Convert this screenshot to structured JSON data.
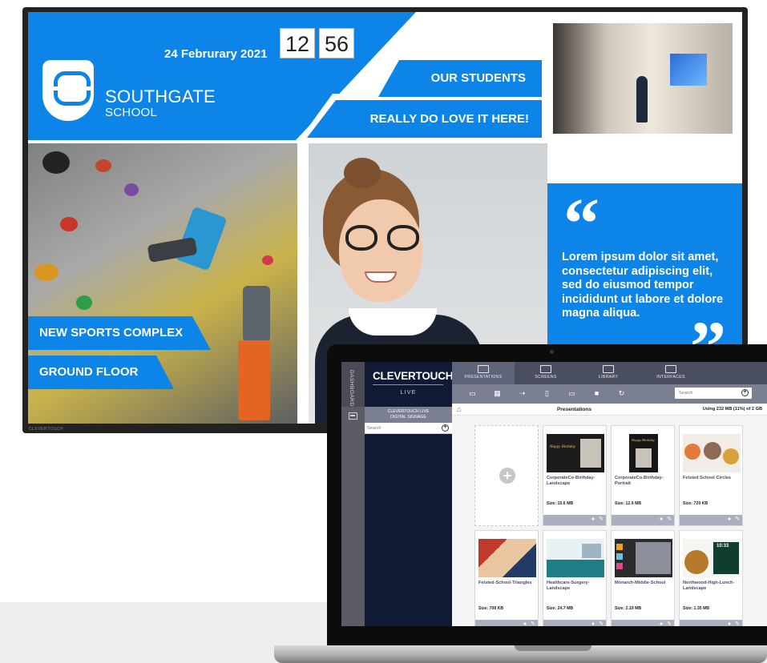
{
  "signage": {
    "date": "24 Februrary 2021",
    "clock_hours": "12",
    "clock_minutes": "56",
    "school_name": "SOUTHGATE",
    "school_sub": "SCHOOL",
    "banner_1": "OUR STUDENTS",
    "banner_2": "REALLY DO LOVE IT HERE!",
    "sports_1": "NEW SPORTS COMPLEX",
    "sports_2": "GROUND FLOOR",
    "quote": "Lorem ipsum dolor sit amet, consectetur adipiscing elit, sed do eiusmod tempor incididunt ut labore et dolore magna aliqua.",
    "quote_open": "“",
    "quote_close": "”",
    "tv_brand": "CLEVERTOUCH"
  },
  "app": {
    "dashboard_label": "DASHBOARD",
    "brand": "CLEVERTOUCH®",
    "brand_sub": "LIVE",
    "nav": [
      "PRESENTATIONS",
      "SCREENS",
      "LIBRARY",
      "INTERFACES"
    ],
    "search_placeholder": "Search",
    "side_title_1": "CLEVERTOUCH LIVE",
    "side_title_2": "DIGITAL SIGNAGE",
    "side_search_placeholder": "Search",
    "page_title": "Presentations",
    "usage": "Using 232 MB (11%) of 2 GB",
    "cards": [
      {
        "title": "CorporateCo-Birthday-Landscape",
        "size": "Size: 15.6 MB"
      },
      {
        "title": "CorporateCo-Birthday-Portrait",
        "size": "Size: 12.9 MB"
      },
      {
        "title": "Felsted School Circles",
        "size": "Size: 720 KB"
      },
      {
        "title": "Felsted-School-Triangles",
        "size": "Size: 708 KB"
      },
      {
        "title": "Healthcare-Surgery-Landscape",
        "size": "Size: 24.7 MB"
      },
      {
        "title": "Monarch-Middle-School",
        "size": "Size: 2.19 MB"
      },
      {
        "title": "Northwood-High-Lunch-Landscape",
        "size": "Size: 1.35 MB"
      }
    ],
    "thumb_texts": {
      "birthday": "Happy Birthday",
      "clock": "10:33"
    }
  },
  "colors": {
    "signage_blue": "#0d85e8",
    "app_navy": "#101a35",
    "app_nav": "#4a4f60"
  }
}
